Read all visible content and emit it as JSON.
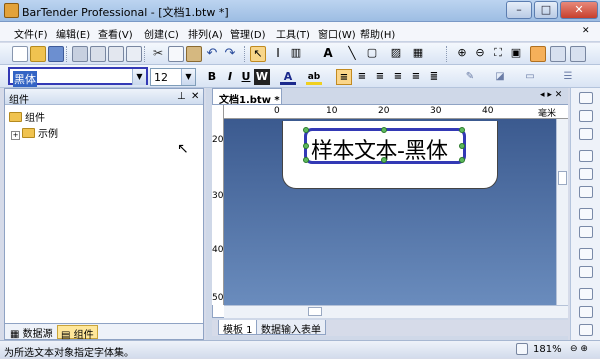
{
  "window": {
    "title": "BarTender Professional - [文档1.btw *]"
  },
  "menu": [
    "文件(F)",
    "编辑(E)",
    "查看(V)",
    "创建(C)",
    "排列(A)",
    "管理(D)",
    "工具(T)",
    "窗口(W)",
    "帮助(H)"
  ],
  "font": {
    "name": "黑体",
    "size": "12"
  },
  "left_panel": {
    "title": "组件",
    "tree": {
      "root": "组件",
      "child": "示例"
    },
    "tabs": [
      "数据源",
      "组件"
    ]
  },
  "document": {
    "tab": "文档1.btw *",
    "ruler_labels": [
      "0",
      "10",
      "20",
      "30",
      "40",
      "毫米"
    ],
    "vruler_labels": [
      "20",
      "30",
      "40",
      "50"
    ],
    "sample_text": "样本文本-黑体",
    "bottom_tabs": [
      "模板 1",
      "数据输入表单"
    ]
  },
  "status": {
    "text": "为所选文本对象指定字体集。",
    "zoom": "181%"
  },
  "colors": {
    "accent": "#3339b5",
    "canvas": "#4a6aa0"
  }
}
